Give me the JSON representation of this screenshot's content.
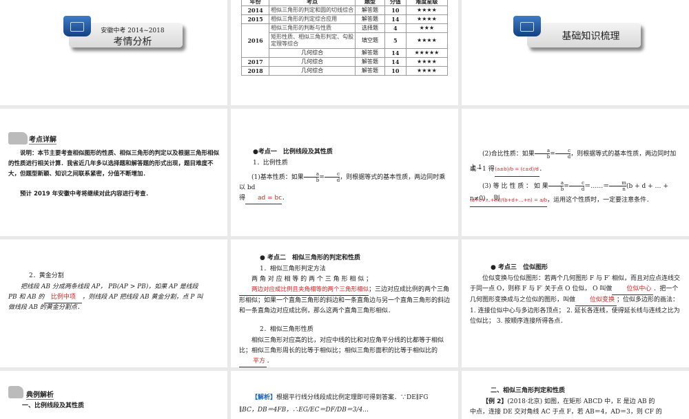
{
  "slide1": {
    "subtitle": "安徽中考 2014~2018",
    "title": "考情分析"
  },
  "slide2": {
    "headers": [
      "年份",
      "考点",
      "题型",
      "分值",
      "难度星级"
    ],
    "rows": [
      {
        "year": "2014",
        "topic": "相似三角形的判定和圆的切线综合",
        "type": "解答题",
        "score": "10",
        "stars": "★★★★"
      },
      {
        "year": "2015",
        "topic": "相似三角形的判定综合应用",
        "type": "解答题",
        "score": "14",
        "stars": "★★★★"
      },
      {
        "year": "2016",
        "topic": "相似三角形的判断与性质",
        "type": "选择题",
        "score": "4",
        "stars": "★★★"
      },
      {
        "year": "",
        "topic": "矩形性质、相似三角形判定、勾股定理等综合",
        "type": "填空题",
        "score": "5",
        "stars": "★★★★"
      },
      {
        "year": "",
        "topic": "几何综合",
        "type": "解答题",
        "score": "14",
        "stars": "★★★★★"
      },
      {
        "year": "2017",
        "topic": "几何综合",
        "type": "解答题",
        "score": "14",
        "stars": "★★★★"
      },
      {
        "year": "2018",
        "topic": "几何综合",
        "type": "解答题",
        "score": "10",
        "stars": "★★★★"
      }
    ]
  },
  "slide3": {
    "title": "基础知识梳理"
  },
  "slide4": {
    "heading": "考点详解",
    "p1": "说明：本节主要考查相似图形的性质、相似三角形的判定以及根据三角形相似的性质进行相关计算．我省近几年多以选择题和解答题的形式出现，题目难度不大，但题型新颖、知识之间联系紧密，分值不断增加．",
    "p2": "预计 2019 年安徽中考将继续对此内容进行考查．"
  },
  "slide5": {
    "heading": "●考点一　比例线段及其性质",
    "sub": "1．比例性质",
    "p1a": "(1)基本性质：如果",
    "p1b": "，则根据等式的基本性质，两边同时乘以 bd",
    "p1c": "得",
    "answer": "ad = bc",
    "end": "．"
  },
  "slide6": {
    "p1a": "(2)合比性质：如果",
    "p1b": "，则根据等式的基本性质，两边同时加上 1",
    "p1c": "或－1 得",
    "ans1": "(a±b)/b = (c±d)/d",
    "p2a": "(3) 等 比 性 质 ： 如 果",
    "p2b": "＝……＝",
    "p2c": "(b + d + … + n≠0)， 则",
    "ans2": "(a+c+…+m)/(b+d+…+n) = a/b",
    "p2d": "，运用这个性质时，一定要注意条件．"
  },
  "slide7": {
    "sub": "2．黄金分割",
    "p1": "把线段 AB 分成两条线段 AP， PB(AP > PB)，如果 AP 是线段",
    "p2a": "PB 和 AB 的",
    "answer": "比例中项",
    "p2b": "，则线段 AP 把线段 AB 黄金分割，点 P 叫",
    "p3": "做线段 AB 的黄金分割点．"
  },
  "slide8": {
    "heading": "● 考点二　相似三角形的判定和性质",
    "sub1": "1．相似三角形判定方法",
    "p1a": "两 角 对 应 相 等 的 两 个 三 角 形 相 似 ；",
    "ans1": "两边对应成比例且夹角相等的两个三角形相似",
    "p1b": "；三边对应成比例的两个三角形相似；如果一个直角三角形的斜边和一条直角边与另一个直角三角形的斜边和一条直角边对应成比例，那么这两个直角三角形相似．",
    "sub2": "2．相似三角形性质",
    "p2a": "相似三角形对应高的比，对应中线的比和对应角平分线的比都等于相似比；相似三角形周长的比等于相似比；相似三角形面积的比等于相似比的",
    "ans2": "平方",
    "end": "．"
  },
  "slide9": {
    "heading": "● 考点三　位似图形",
    "p1": "位似变换与位似图形：若两个几何图形 F 与 F′ 相似，而且对应点连线交于同一点 O，则称 F 与 F′ 关于点 O 位似， O 叫做",
    "ans1": "位似中心",
    "p2": "．把一个几何图形变换成与之位似的图形，叫做",
    "ans2": "位似变换",
    "p3": "；位似多边形的画法： 1. 连接位似中心与多边形各顶点； 2. 延长各连线，使得延长线与连线之比为位似比； 3. 按顺序连接所得各点．"
  },
  "slide10": {
    "heading": "典例解析",
    "sub": "一、比例线段及其性质"
  },
  "slide11": {
    "tag": "【解析】",
    "p1": "根据平行线分线段成比例定理即可得到答案．∵DE∥FG",
    "p2": "∥BC，DB＝4FB，∴EG/EC＝DF/DB＝3/4..."
  },
  "slide12": {
    "heading": "二、相似三角形判定和性质",
    "example": "【例 2】",
    "p1": "(2018·北京) 如图，在矩形 ABCD 中，E 是边 AB 的",
    "p2": "中点，连接 DE 交对角线 AC 于点 F，若 AB＝4，AD＝3，则 CF 的"
  },
  "colors": {
    "answer": "#dd2222",
    "folder": "#1f4f96",
    "background": "#e9e9e9"
  }
}
